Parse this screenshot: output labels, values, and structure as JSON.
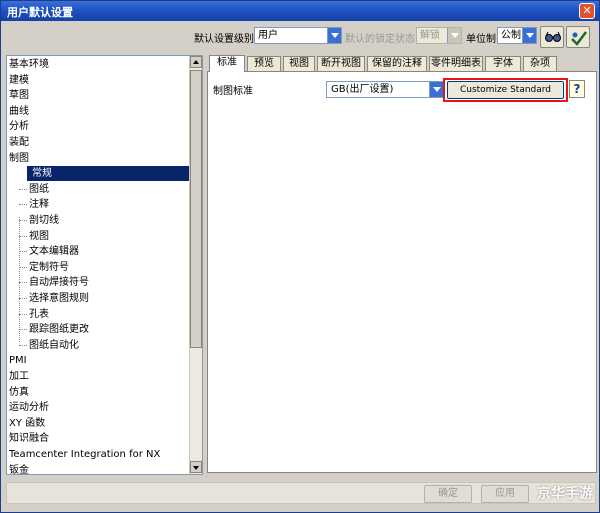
{
  "window": {
    "title": "用户默认设置",
    "close_glyph": "✕"
  },
  "toolbar": {
    "level_label": "默认设置级别",
    "level_value": "用户",
    "lock_label": "默认的锁定状态",
    "lock_value": "解锁",
    "unit_label": "单位制",
    "unit_value": "公制"
  },
  "tree": {
    "items": [
      "基本环境",
      "建模",
      "草图",
      "曲线",
      "分析",
      "装配",
      "制图",
      "常规",
      "图纸",
      "注释",
      "剖切线",
      "视图",
      "文本编辑器",
      "定制符号",
      "自动焊接符号",
      "选择意图规则",
      "孔表",
      "跟踪图纸更改",
      "图纸自动化",
      "PMI",
      "加工",
      "仿真",
      "运动分析",
      "XY 函数",
      "知识融合",
      "Teamcenter Integration for NX",
      "钣金"
    ],
    "selected": "常规"
  },
  "tabs": [
    "标准",
    "预览",
    "视图",
    "断开视图",
    "保留的注释",
    "零件明细表",
    "字体",
    "杂项"
  ],
  "active_tab": "标准",
  "standard": {
    "label": "制图标准",
    "value": "GB(出厂设置)",
    "customize_label": "Customize Standard",
    "help_glyph": "?"
  },
  "footer": {
    "ok_label": "确定",
    "apply_label": "应用",
    "watermark": "京华手游"
  },
  "colors": {
    "titlebar": "#1f52c4",
    "selection": "#0a246a",
    "highlight": "#e8141a"
  },
  "icons": [
    "close-icon",
    "combo-arrow-icon",
    "glasses-icon",
    "check-icon",
    "help-icon",
    "scroll-up-icon",
    "scroll-down-icon"
  ]
}
